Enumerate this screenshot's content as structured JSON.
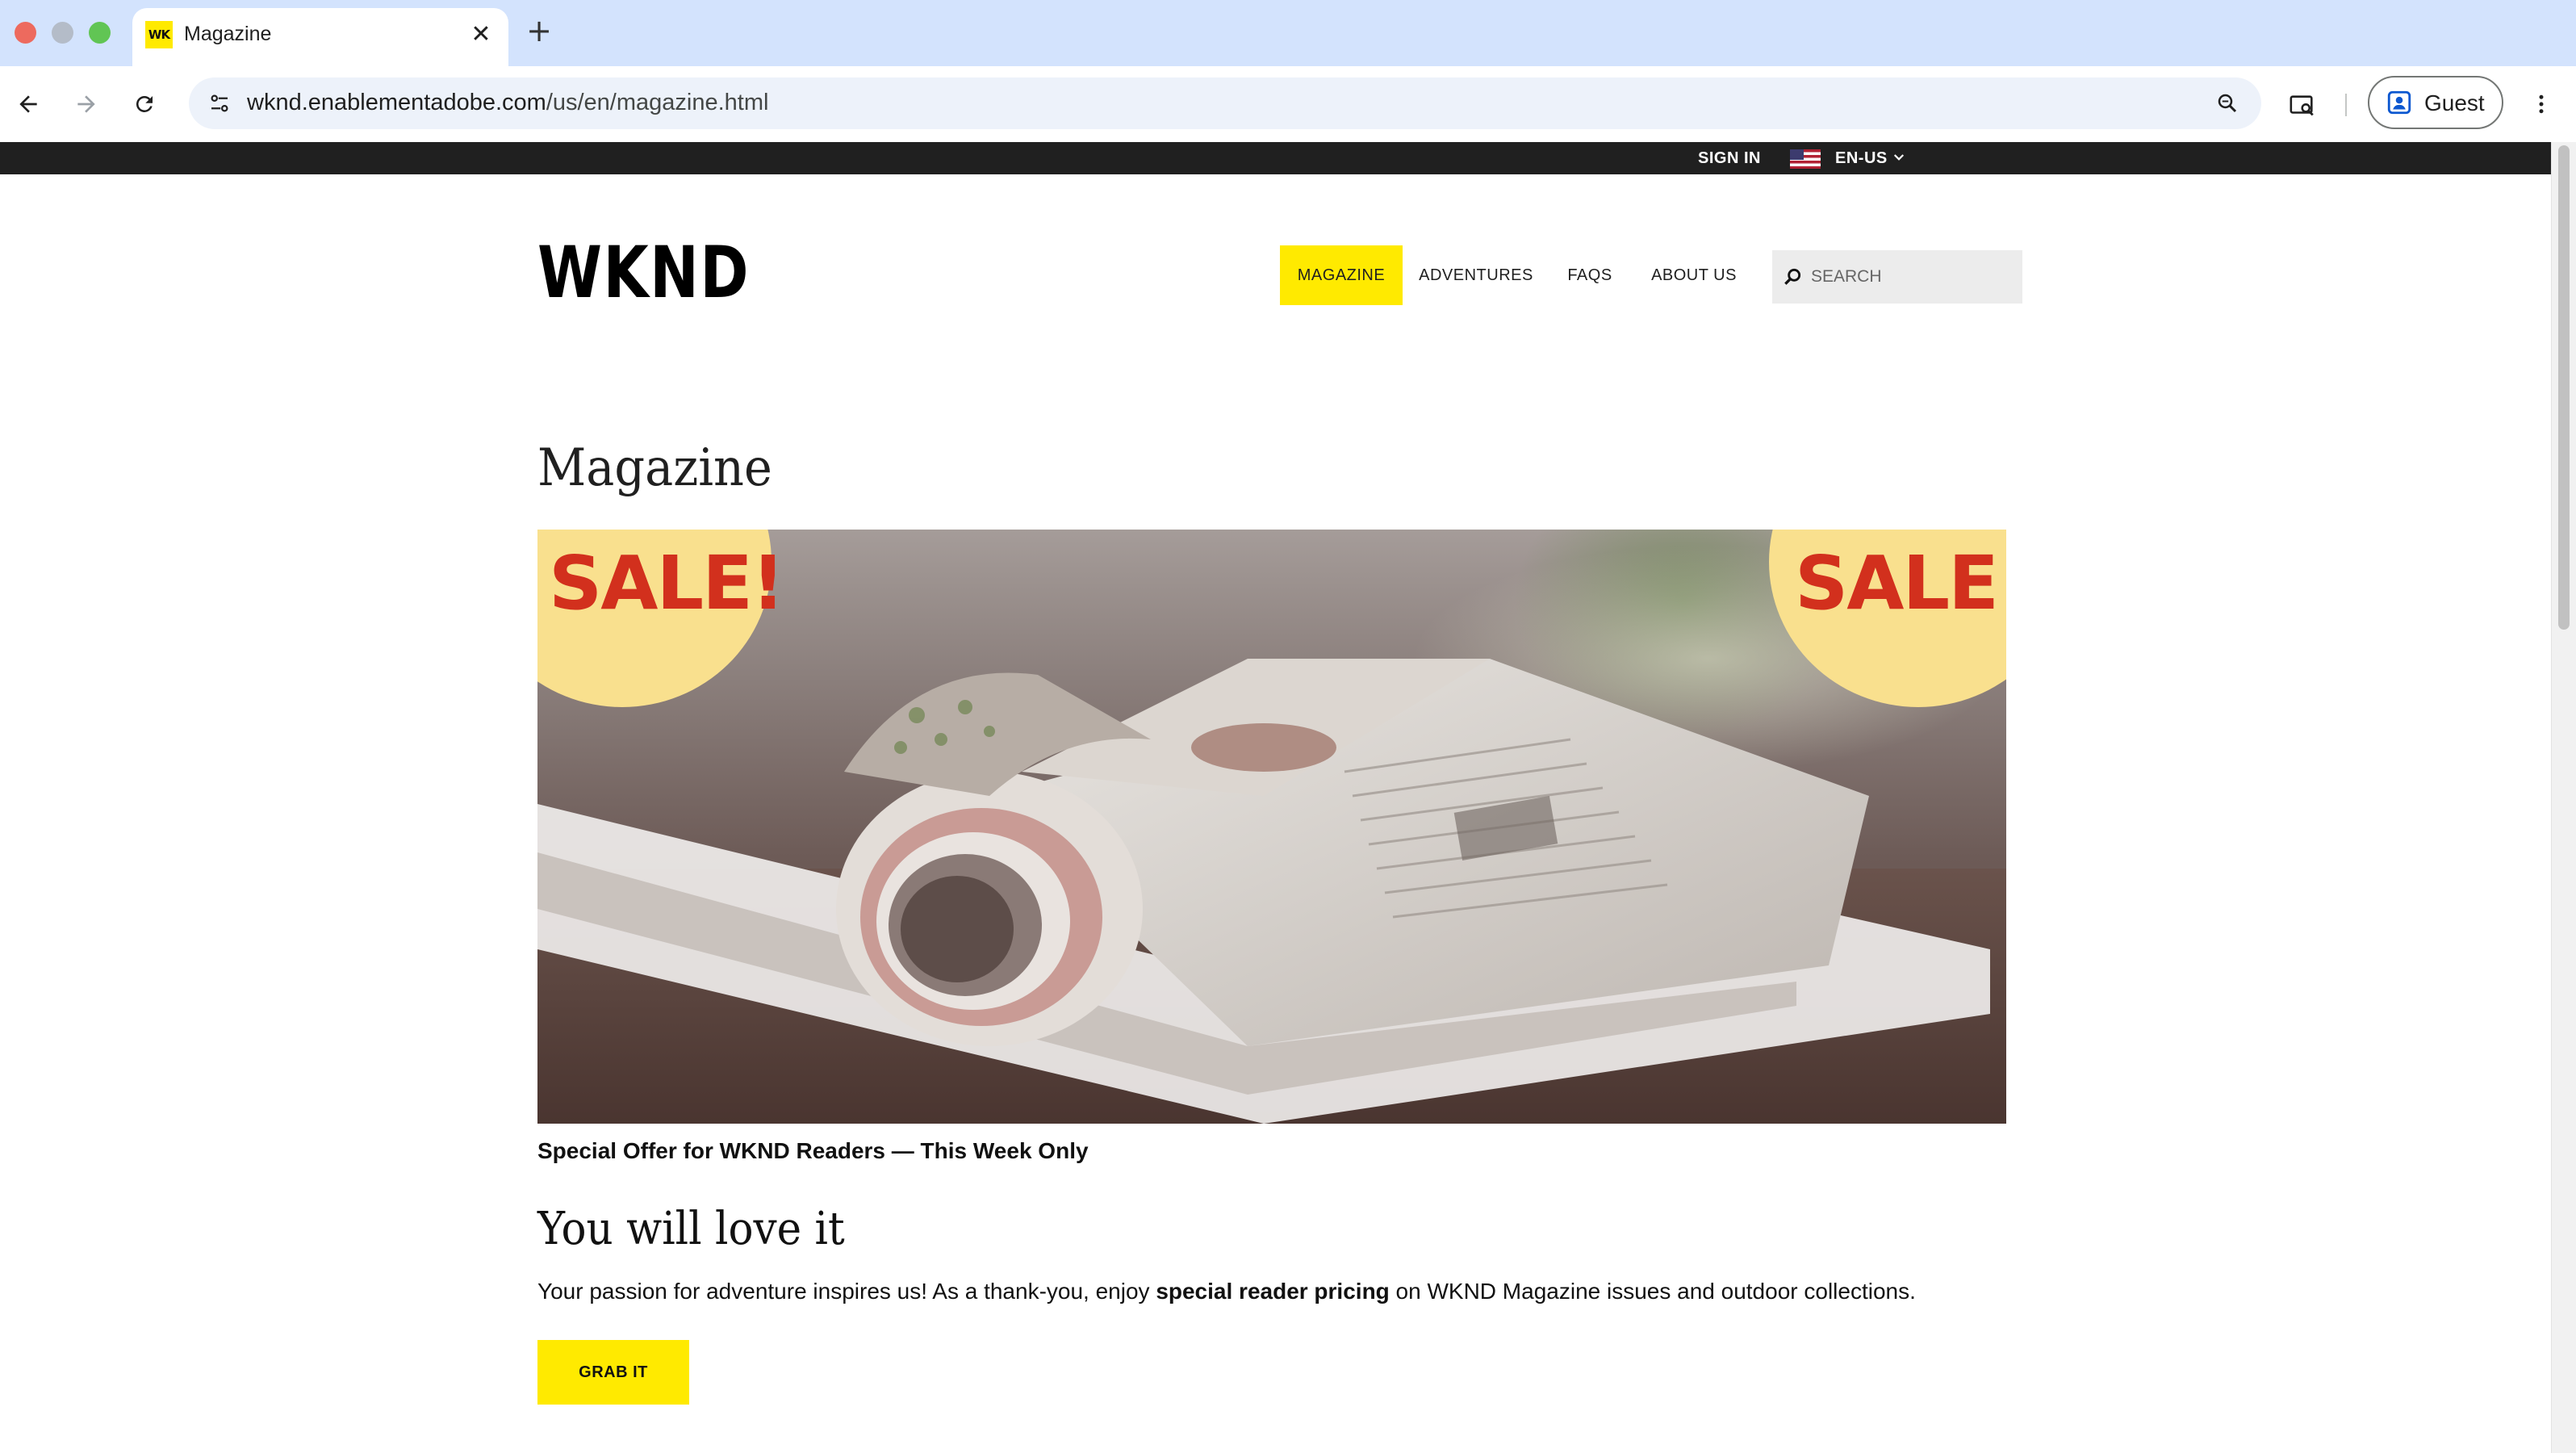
{
  "browser": {
    "tab": {
      "favicon_text": "WK",
      "title": "Magazine",
      "close_symbol": "✕"
    },
    "new_tab_symbol": "+",
    "url_host": "wknd.enablementadobe.com",
    "url_path": "/us/en/magazine.html",
    "profile_label": "Guest",
    "icons": [
      "back-arrow-icon",
      "forward-arrow-icon",
      "reload-icon",
      "site-info-icon",
      "zoom-icon",
      "cast-search-icon",
      "profile-icon",
      "kebab-menu-icon"
    ]
  },
  "utility": {
    "signin_label": "SIGN IN",
    "language_label": "EN-US"
  },
  "header": {
    "logo": "WKND",
    "nav": {
      "magazine": "MAGAZINE",
      "adventures": "ADVENTURES",
      "faqs": "FAQS",
      "about": "ABOUT US"
    },
    "search_placeholder": "SEARCH"
  },
  "main": {
    "title": "Magazine",
    "hero": {
      "sale_left": "SALE!",
      "sale_right": "SALE!"
    },
    "caption": "Special Offer for WKND Readers — This Week Only",
    "section_heading": "You will love it",
    "body_before": "Your passion for adventure inspires us! As a thank-you, enjoy ",
    "body_bold": "special reader pricing",
    "body_after": " on WKND Magazine issues and outdoor collections.",
    "cta_label": "GRAB IT"
  },
  "colors": {
    "accent_yellow": "#ffea00",
    "sale_red": "#d2301d",
    "sale_circle": "#f9e08e",
    "utility_bar": "#202020",
    "tab_strip": "#d3e3fd"
  }
}
